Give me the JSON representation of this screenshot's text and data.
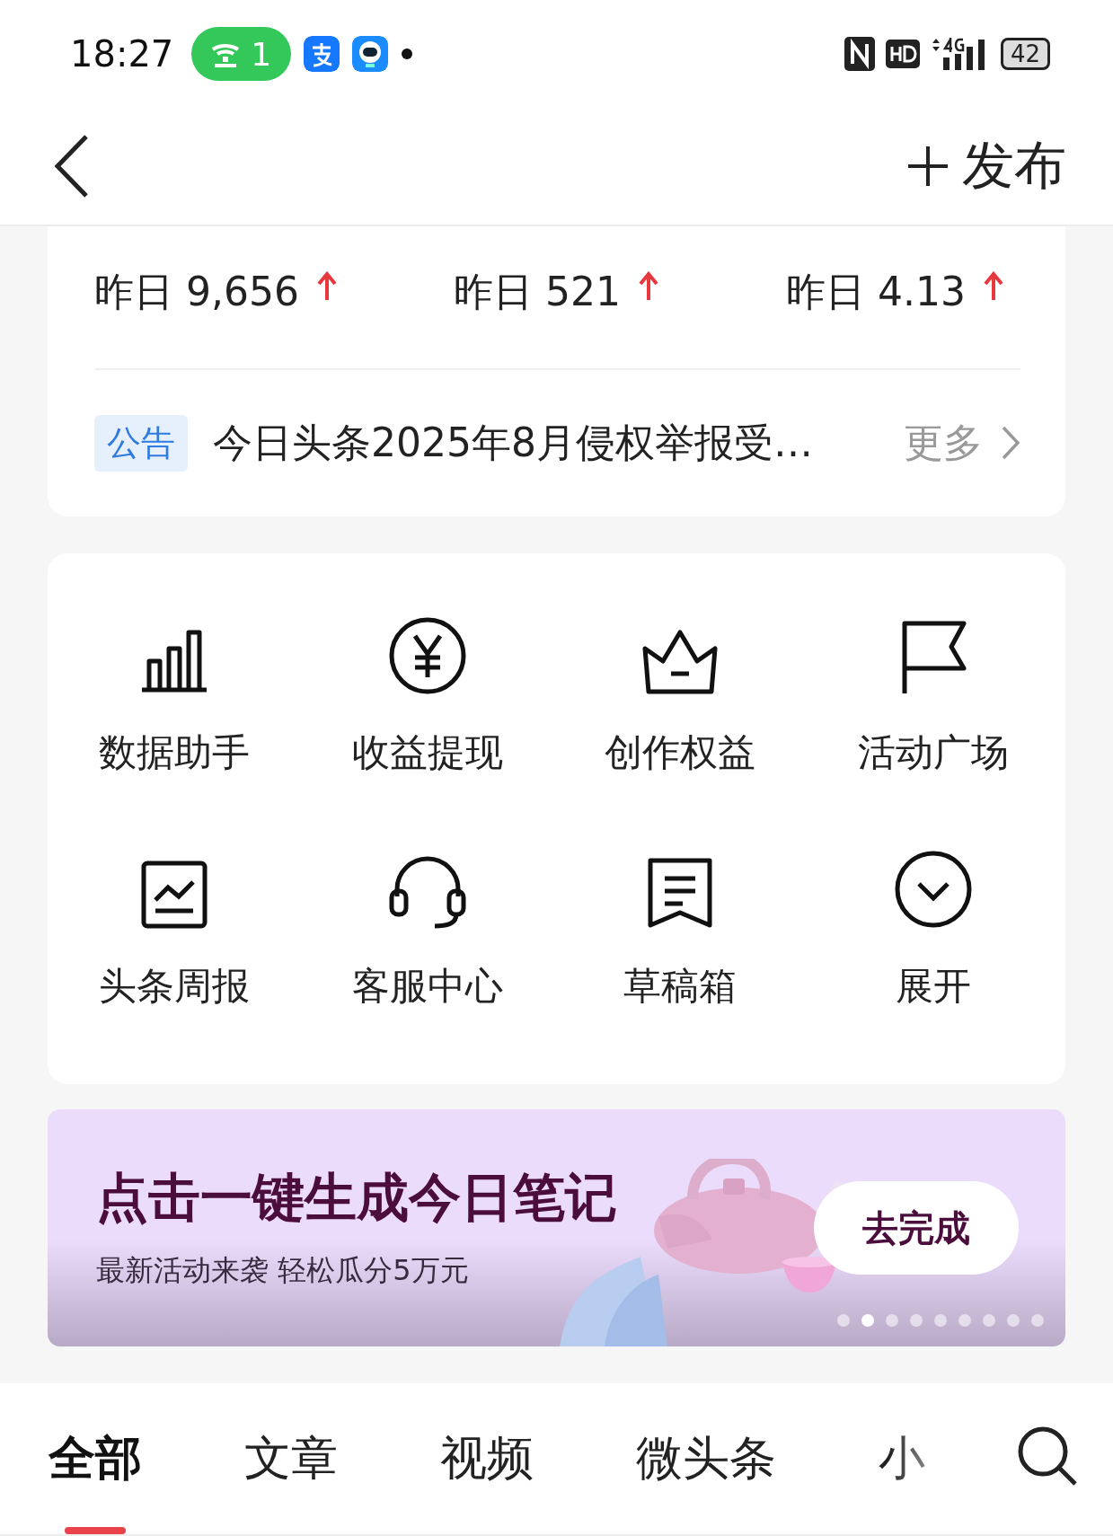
{
  "status_bar": {
    "time": "18:27",
    "hotspot_count": "1",
    "battery": "42"
  },
  "header": {
    "publish": "发布"
  },
  "stats": [
    {
      "label": "昨日 9,656"
    },
    {
      "label": "昨日 521"
    },
    {
      "label": "昨日 4.13"
    }
  ],
  "notice": {
    "tag": "公告",
    "text": "今日头条2025年8月侵权举报受…",
    "more": "更多"
  },
  "tools": [
    {
      "label": "数据助手"
    },
    {
      "label": "收益提现"
    },
    {
      "label": "创作权益"
    },
    {
      "label": "活动广场"
    },
    {
      "label": "头条周报"
    },
    {
      "label": "客服中心"
    },
    {
      "label": "草稿箱"
    },
    {
      "label": "展开"
    }
  ],
  "banner": {
    "title": "点击一键生成今日笔记",
    "subtitle": "最新活动来袭 轻松瓜分5万元",
    "button": "去完成",
    "dots": [
      {
        "selected": false
      },
      {
        "selected": true
      },
      {
        "selected": false
      },
      {
        "selected": false
      },
      {
        "selected": false
      },
      {
        "selected": false
      },
      {
        "selected": false
      },
      {
        "selected": false
      },
      {
        "selected": false
      }
    ]
  },
  "tabs": [
    {
      "label": "全部",
      "selected": true
    },
    {
      "label": "文章",
      "selected": false
    },
    {
      "label": "视频",
      "selected": false
    },
    {
      "label": "微头条",
      "selected": false
    },
    {
      "label": "小",
      "selected": false
    }
  ]
}
